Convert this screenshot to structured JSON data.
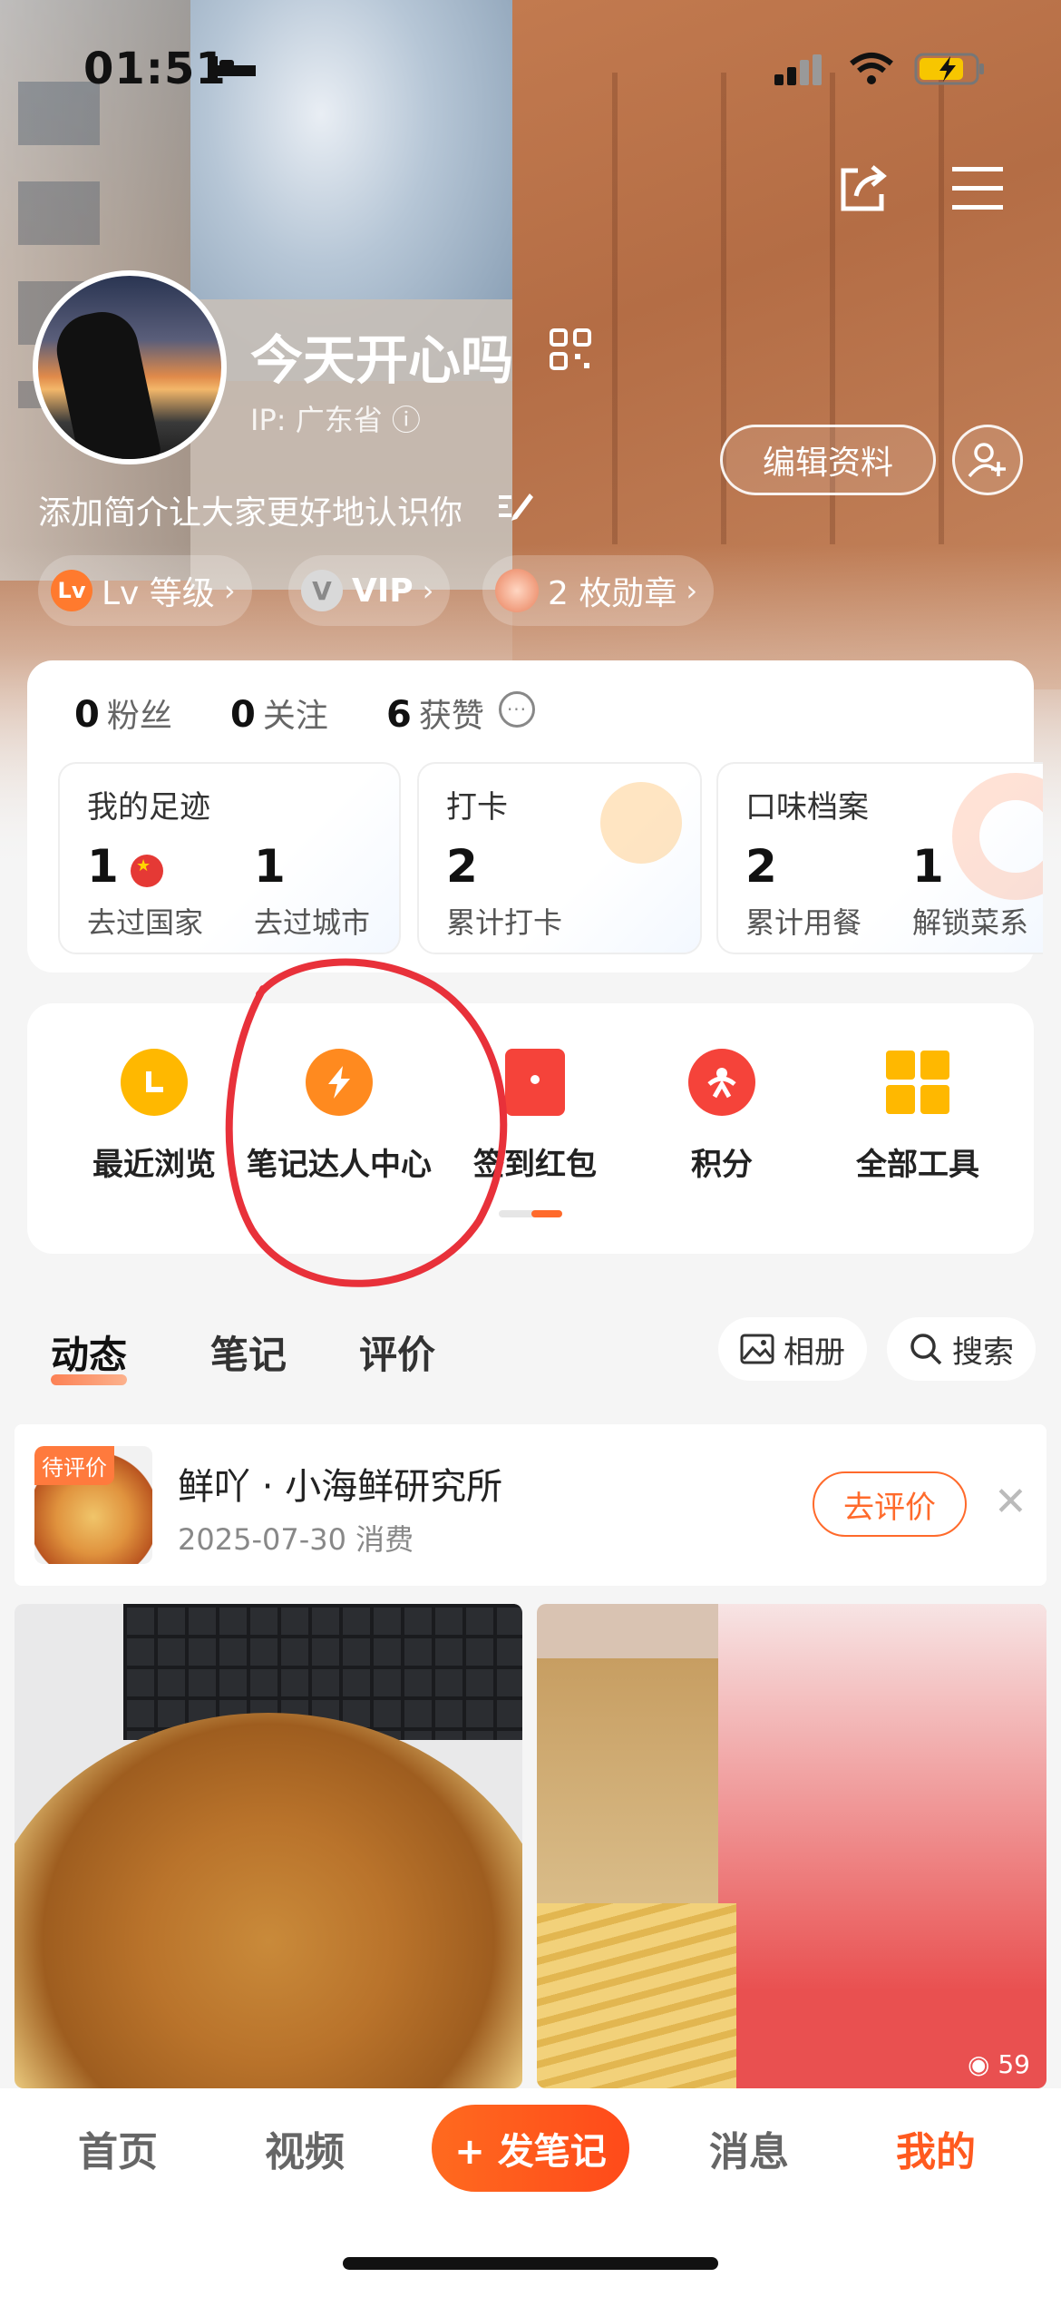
{
  "status_bar": {
    "time": "01:51"
  },
  "profile": {
    "username": "今天开心吗",
    "ip": "IP: 广东省",
    "bio_placeholder": "添加简介让大家更好地认识你",
    "edit_profile_label": "编辑资料"
  },
  "chips": {
    "level": {
      "badge": "Lv",
      "label": "Lv 等级"
    },
    "vip": {
      "badge": "V",
      "label": "VIP"
    },
    "medals": {
      "label": "2 枚勋章"
    }
  },
  "stats": {
    "fans": {
      "num": "0",
      "label": "粉丝"
    },
    "following": {
      "num": "0",
      "label": "关注"
    },
    "likes": {
      "num": "6",
      "label": "获赞"
    }
  },
  "mini_cards": {
    "footprint": {
      "title": "我的足迹",
      "countries_num": "1",
      "countries_label": "去过国家",
      "cities_num": "1",
      "cities_label": "去过城市"
    },
    "checkin": {
      "title": "打卡",
      "num": "2",
      "label": "累计打卡"
    },
    "taste": {
      "title": "口味档案",
      "meals_num": "2",
      "meals_label": "累计用餐",
      "dishes_num": "1",
      "dishes_label": "解锁菜系"
    }
  },
  "tools": [
    {
      "label": "最近浏览",
      "icon": "clock-icon",
      "color": "#ffb800"
    },
    {
      "label": "笔记达人中心",
      "icon": "lightning-icon",
      "color": "#ff8a1f"
    },
    {
      "label": "签到红包",
      "icon": "red-envelope-icon",
      "color": "#f5433a"
    },
    {
      "label": "积分",
      "icon": "points-icon",
      "color": "#f5433a"
    },
    {
      "label": "全部工具",
      "icon": "grid-icon",
      "color": "#ffb800"
    }
  ],
  "tabs": [
    {
      "label": "动态",
      "active": true
    },
    {
      "label": "笔记",
      "active": false
    },
    {
      "label": "评价",
      "active": false
    }
  ],
  "actions": {
    "album": "相册",
    "search": "搜索"
  },
  "review": {
    "badge": "待评价",
    "title": "鲜吖 · 小海鲜研究所",
    "date": "2025-07-30 消费",
    "button": "去评价"
  },
  "photos": [
    {
      "alt": "wonton noodles"
    },
    {
      "alt": "fried chicken",
      "views": "59"
    }
  ],
  "bottom_nav": {
    "home": "首页",
    "video": "视频",
    "post": "+ 发笔记",
    "messages": "消息",
    "mine": "我的"
  },
  "colors": {
    "accent": "#ff5a1f",
    "highlight_circle": "#e8313a"
  }
}
